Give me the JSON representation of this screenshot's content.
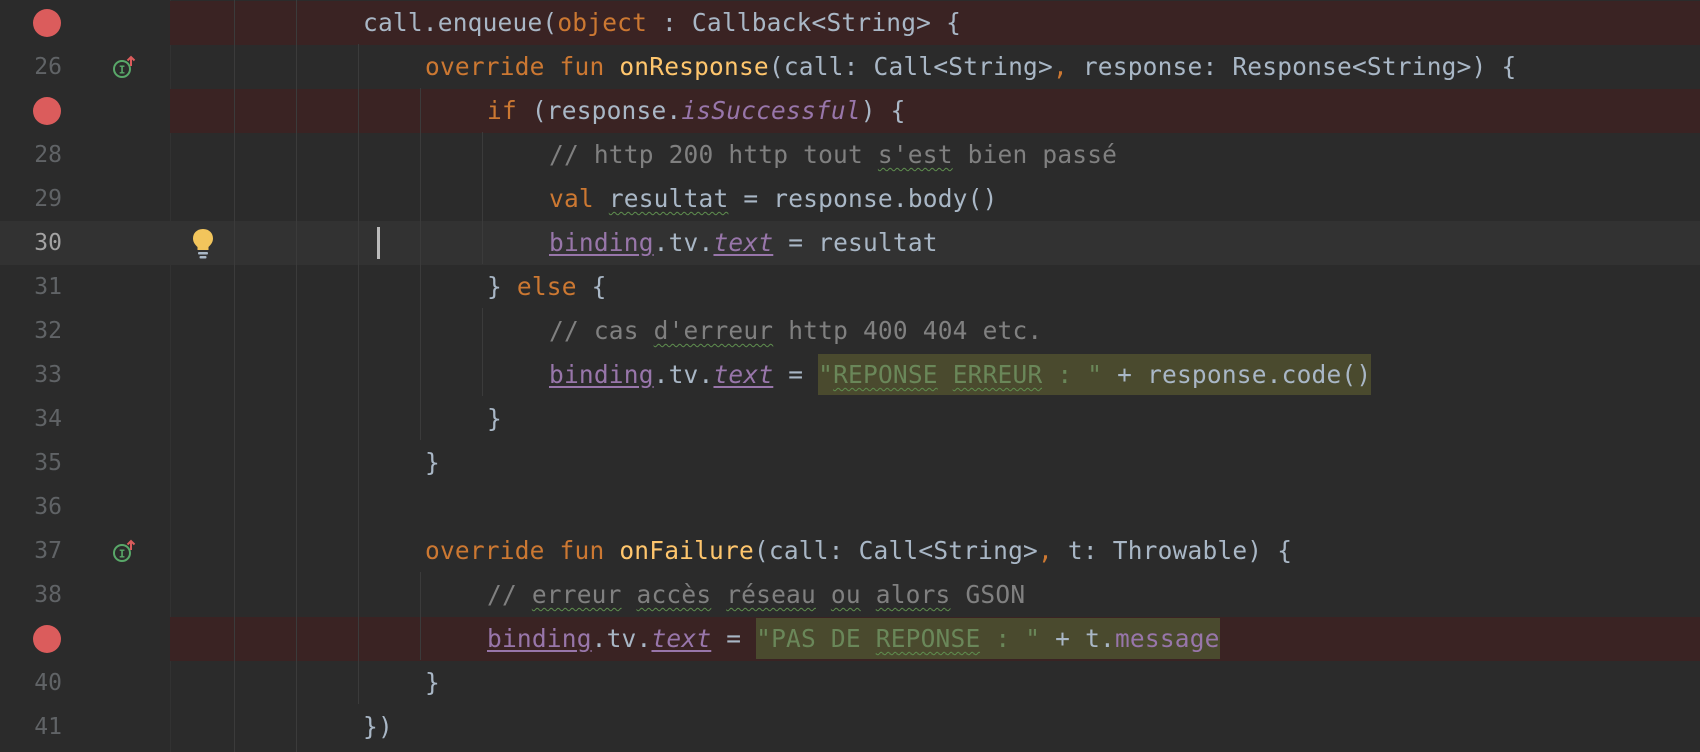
{
  "editor": {
    "lines": [
      {
        "num": "",
        "bp": true,
        "parts": [
          {
            "t": "call.enqueue(",
            "c": ""
          },
          {
            "t": "object",
            "c": "kw"
          },
          {
            "t": " : Callback<String> {",
            "c": ""
          }
        ]
      },
      {
        "num": "26",
        "impl": true,
        "parts": [
          {
            "t": "override fun ",
            "c": "kw"
          },
          {
            "t": "onResponse",
            "c": "fn"
          },
          {
            "t": "(call: Call<String>",
            "c": ""
          },
          {
            "t": ",",
            "c": "kw"
          },
          {
            "t": " response: Response<String>) {",
            "c": ""
          }
        ]
      },
      {
        "num": "",
        "bp": true,
        "parts": [
          {
            "t": "if",
            "c": "kw"
          },
          {
            "t": " (response.",
            "c": ""
          },
          {
            "t": "isSuccessful",
            "c": "prop it"
          },
          {
            "t": ") {",
            "c": ""
          }
        ]
      },
      {
        "num": "28",
        "parts": [
          {
            "t": "// http 200 http tout ",
            "c": "cm"
          },
          {
            "t": "s'est",
            "c": "cm wavy"
          },
          {
            "t": " bien passé",
            "c": "cm"
          }
        ]
      },
      {
        "num": "29",
        "parts": [
          {
            "t": "val ",
            "c": "kw"
          },
          {
            "t": "resultat",
            "c": "wavy"
          },
          {
            "t": " = response.body()",
            "c": ""
          }
        ]
      },
      {
        "num": "30",
        "caret": true,
        "bulb": true,
        "parts": [
          {
            "t": "binding",
            "c": "prop ul"
          },
          {
            "t": ".tv.",
            "c": ""
          },
          {
            "t": "text",
            "c": "prop it ul"
          },
          {
            "t": " = resultat",
            "c": ""
          }
        ]
      },
      {
        "num": "31",
        "parts": [
          {
            "t": "} ",
            "c": ""
          },
          {
            "t": "else",
            "c": "kw"
          },
          {
            "t": " {",
            "c": ""
          }
        ]
      },
      {
        "num": "32",
        "parts": [
          {
            "t": "// cas ",
            "c": "cm"
          },
          {
            "t": "d'erreur",
            "c": "cm wavy"
          },
          {
            "t": " http 400 404 etc.",
            "c": "cm"
          }
        ]
      },
      {
        "num": "33",
        "parts": [
          {
            "t": "binding",
            "c": "prop ul"
          },
          {
            "t": ".tv.",
            "c": ""
          },
          {
            "t": "text",
            "c": "prop it ul"
          },
          {
            "t": " = ",
            "c": ""
          },
          {
            "t": "\"",
            "c": "str hl"
          },
          {
            "t": "REPONSE",
            "c": "str hl wavy"
          },
          {
            "t": " ",
            "c": "str hl"
          },
          {
            "t": "ERREUR",
            "c": "str hl wavy"
          },
          {
            "t": " : \"",
            "c": "str hl"
          },
          {
            "t": " + response.code()",
            "c": "hl"
          }
        ]
      },
      {
        "num": "34",
        "parts": [
          {
            "t": "}",
            "c": ""
          }
        ]
      },
      {
        "num": "35",
        "parts": [
          {
            "t": "}",
            "c": ""
          }
        ]
      },
      {
        "num": "36",
        "parts": []
      },
      {
        "num": "37",
        "impl": true,
        "parts": [
          {
            "t": "override fun ",
            "c": "kw"
          },
          {
            "t": "onFailure",
            "c": "fn"
          },
          {
            "t": "(call: Call<String>",
            "c": ""
          },
          {
            "t": ",",
            "c": "kw"
          },
          {
            "t": " t: Throwable) {",
            "c": ""
          }
        ]
      },
      {
        "num": "38",
        "parts": [
          {
            "t": "// ",
            "c": "cm"
          },
          {
            "t": "erreur",
            "c": "cm wavy"
          },
          {
            "t": " ",
            "c": "cm"
          },
          {
            "t": "accès",
            "c": "cm wavy"
          },
          {
            "t": " ",
            "c": "cm"
          },
          {
            "t": "réseau",
            "c": "cm wavy"
          },
          {
            "t": " ",
            "c": "cm"
          },
          {
            "t": "ou",
            "c": "cm wavy"
          },
          {
            "t": " ",
            "c": "cm"
          },
          {
            "t": "alors",
            "c": "cm wavy"
          },
          {
            "t": " GSON",
            "c": "cm"
          }
        ]
      },
      {
        "num": "",
        "bp": true,
        "parts": [
          {
            "t": "binding",
            "c": "prop ul"
          },
          {
            "t": ".tv.",
            "c": ""
          },
          {
            "t": "text",
            "c": "prop it ul"
          },
          {
            "t": " = ",
            "c": ""
          },
          {
            "t": "\"PAS DE ",
            "c": "str hl"
          },
          {
            "t": "REPONSE",
            "c": "str hl wavy"
          },
          {
            "t": " : \"",
            "c": "str hl"
          },
          {
            "t": " + t.",
            "c": "hl"
          },
          {
            "t": "message",
            "c": "prop hl"
          }
        ]
      },
      {
        "num": "40",
        "parts": [
          {
            "t": "}",
            "c": ""
          }
        ]
      },
      {
        "num": "41",
        "parts": [
          {
            "t": "})",
            "c": ""
          }
        ]
      }
    ]
  },
  "colors": {
    "background": "#2b2b2b",
    "breakpoint": "#db5c5c",
    "keyword": "#cc7832",
    "function": "#ffc66d",
    "comment": "#808080",
    "string": "#6a8759",
    "property": "#9876aa"
  },
  "icons": {
    "breakpoint": "breakpoint-icon",
    "implements": "implements-method-icon",
    "intention": "lightbulb-icon"
  }
}
